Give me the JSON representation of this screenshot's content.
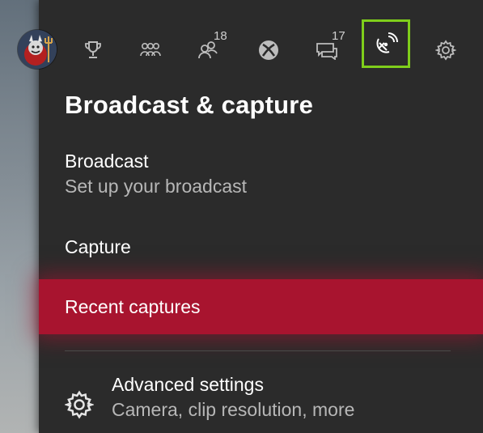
{
  "nav": {
    "items": [
      {
        "name": "trophy"
      },
      {
        "name": "party"
      },
      {
        "name": "friends",
        "badge": "18"
      },
      {
        "name": "xbox"
      },
      {
        "name": "messages",
        "badge": "17"
      },
      {
        "name": "broadcast",
        "active": true
      },
      {
        "name": "settings"
      }
    ],
    "active_color": "#7fce1b"
  },
  "panel": {
    "title": "Broadcast & capture",
    "broadcast": {
      "label": "Broadcast",
      "sub": "Set up your broadcast"
    },
    "capture": {
      "label": "Capture"
    },
    "recent": {
      "label": "Recent captures",
      "highlight_color": "#a8142f"
    },
    "advanced": {
      "label": "Advanced settings",
      "sub": "Camera, clip resolution, more"
    }
  }
}
